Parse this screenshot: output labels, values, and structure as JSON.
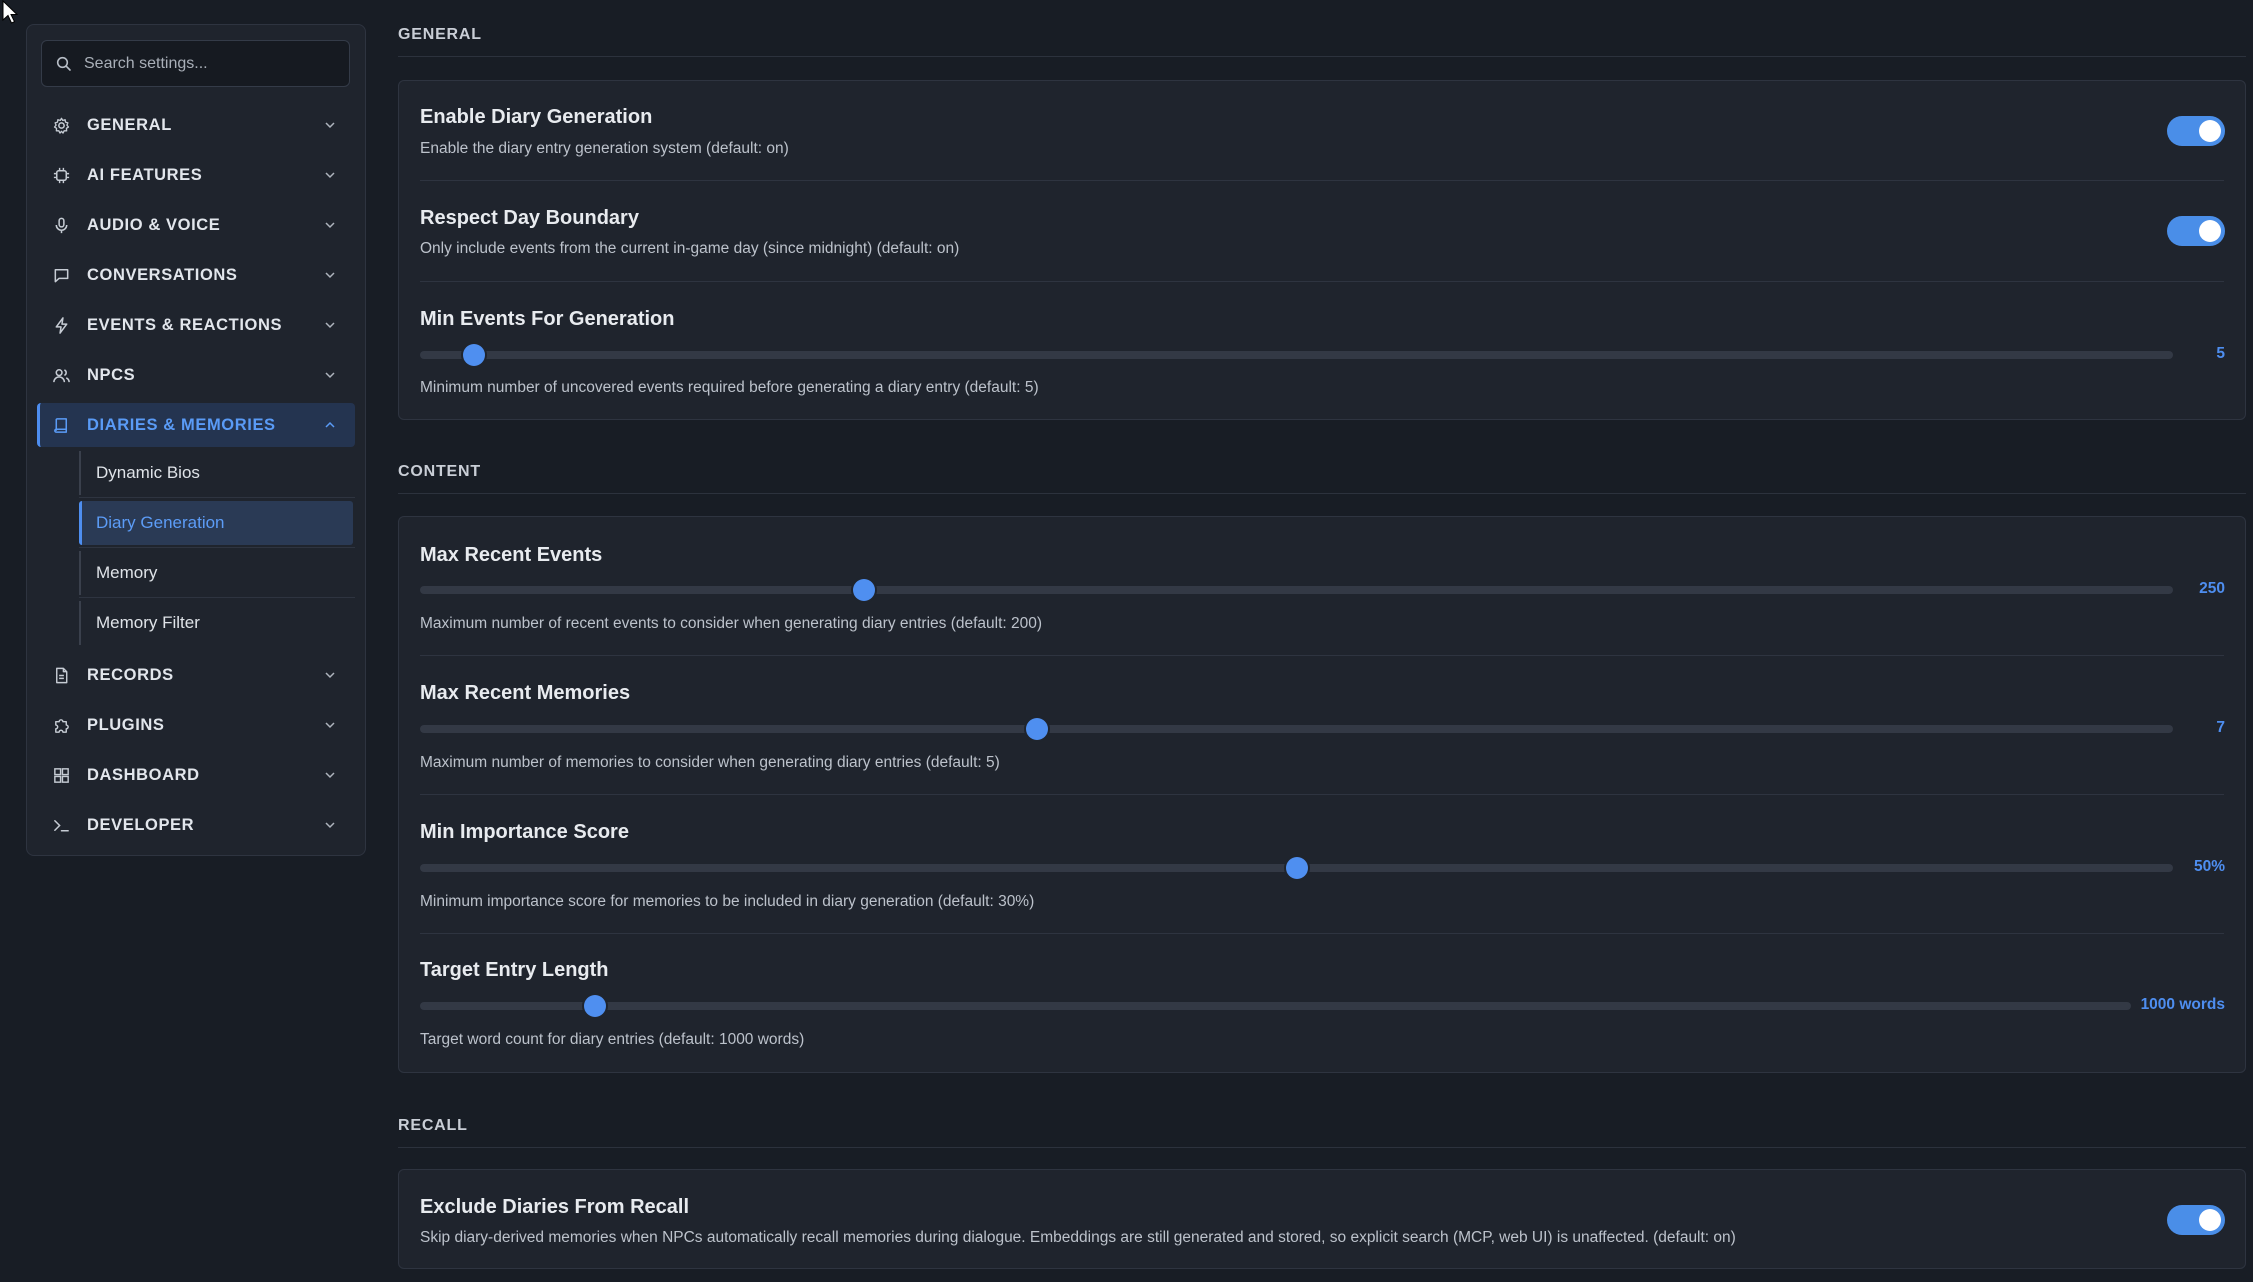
{
  "search": {
    "placeholder": "Search settings..."
  },
  "sidebar": {
    "items": [
      {
        "label": "GENERAL",
        "icon": "gear-icon"
      },
      {
        "label": "AI FEATURES",
        "icon": "chip-icon"
      },
      {
        "label": "AUDIO & VOICE",
        "icon": "microphone-icon"
      },
      {
        "label": "CONVERSATIONS",
        "icon": "chat-bubble-icon"
      },
      {
        "label": "EVENTS & REACTIONS",
        "icon": "lightning-icon"
      },
      {
        "label": "NPCS",
        "icon": "users-icon"
      },
      {
        "label": "DIARIES & MEMORIES",
        "icon": "book-icon",
        "expanded": true
      },
      {
        "label": "RECORDS",
        "icon": "document-icon"
      },
      {
        "label": "PLUGINS",
        "icon": "puzzle-icon"
      },
      {
        "label": "DASHBOARD",
        "icon": "grid-icon"
      },
      {
        "label": "DEVELOPER",
        "icon": "terminal-icon"
      }
    ],
    "subitems": [
      {
        "label": "Dynamic Bios"
      },
      {
        "label": "Diary Generation",
        "active": true
      },
      {
        "label": "Memory"
      },
      {
        "label": "Memory Filter"
      }
    ]
  },
  "sections": {
    "general": {
      "title": "GENERAL",
      "enable_diary": {
        "label": "Enable Diary Generation",
        "desc": "Enable the diary entry generation system (default: on)",
        "enabled": true
      },
      "respect_day": {
        "label": "Respect Day Boundary",
        "desc": "Only include events from the current in-game day (since midnight) (default: on)",
        "enabled": true
      },
      "min_events": {
        "label": "Min Events For Generation",
        "desc": "Minimum number of uncovered events required before generating a diary entry (default: 5)",
        "value": "5",
        "fraction": 0.031
      }
    },
    "content": {
      "title": "CONTENT",
      "max_recent_events": {
        "label": "Max Recent Events",
        "desc": "Maximum number of recent events to consider when generating diary entries (default: 200)",
        "value": "250",
        "fraction": 0.253
      },
      "max_recent_memories": {
        "label": "Max Recent Memories",
        "desc": "Maximum number of memories to consider when generating diary entries (default: 5)",
        "value": "7",
        "fraction": 0.352
      },
      "min_importance": {
        "label": "Min Importance Score",
        "desc": "Minimum importance score for memories to be included in diary generation (default: 30%)",
        "value": "50%",
        "fraction": 0.5
      },
      "target_length": {
        "label": "Target Entry Length",
        "desc": "Target word count for diary entries (default: 1000 words)",
        "value": "1000 words",
        "fraction": 0.102
      }
    },
    "recall": {
      "title": "RECALL",
      "exclude_diaries": {
        "label": "Exclude Diaries From Recall",
        "desc": "Skip diary-derived memories when NPCs automatically recall memories during dialogue. Embeddings are still generated and stored, so explicit search (MCP, web UI) is unaffected. (default: on)",
        "enabled": true
      }
    }
  },
  "colors": {
    "accent": "#4e8ef0",
    "background": "#181d25",
    "card": "#1f242d"
  }
}
